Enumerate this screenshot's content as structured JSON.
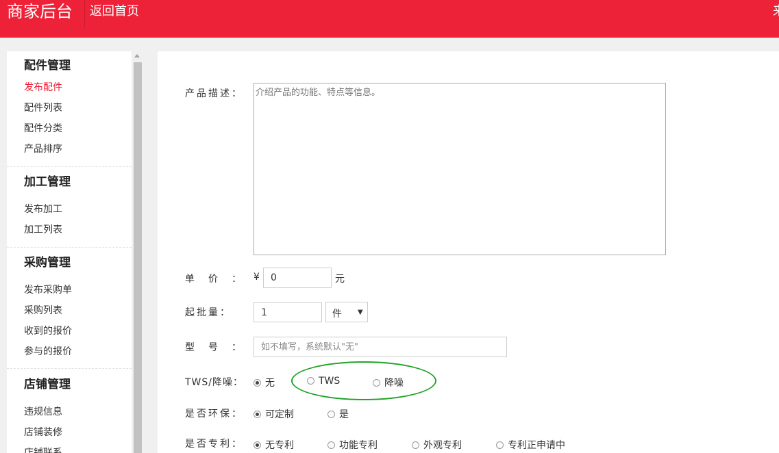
{
  "header": {
    "brand": "商家后台",
    "home_link": "返回首页",
    "user_text_cut": "来"
  },
  "sidebar": {
    "groups": [
      {
        "title": "配件管理",
        "items": [
          {
            "label": "发布配件",
            "active": true
          },
          {
            "label": "配件列表"
          },
          {
            "label": "配件分类"
          },
          {
            "label": "产品排序"
          }
        ]
      },
      {
        "title": "加工管理",
        "items": [
          {
            "label": "发布加工"
          },
          {
            "label": "加工列表"
          }
        ]
      },
      {
        "title": "采购管理",
        "items": [
          {
            "label": "发布采购单"
          },
          {
            "label": "采购列表"
          },
          {
            "label": "收到的报价"
          },
          {
            "label": "参与的报价"
          }
        ]
      },
      {
        "title": "店铺管理",
        "items": [
          {
            "label": "违规信息"
          },
          {
            "label": "店铺装修"
          },
          {
            "label": "店铺联系"
          }
        ]
      }
    ]
  },
  "form": {
    "description": {
      "label": "产品描述：",
      "placeholder": "介绍产品的功能、特点等信息。"
    },
    "price": {
      "label": "单　价　：",
      "currency": "¥",
      "value": "0",
      "unit": "元"
    },
    "min_batch": {
      "label": "起批量：",
      "value": "1",
      "unit_selected": "件"
    },
    "model": {
      "label": "型　号　：",
      "placeholder": "如不填写，系统默认\"无\""
    },
    "tws": {
      "label": "TWS/降噪：",
      "options": [
        "无",
        "TWS",
        "降噪"
      ],
      "selected": 0
    },
    "eco": {
      "label": "是否环保：",
      "options": [
        "可定制",
        "是"
      ],
      "selected": 0
    },
    "patent": {
      "label": "是否专利：",
      "options": [
        "无专利",
        "功能专利",
        "外观专利",
        "专利正申请中"
      ],
      "selected": 0
    }
  },
  "colors": {
    "header_red": "#ed2238",
    "active_red": "#ed2238",
    "annotation_green": "#22a32b"
  }
}
